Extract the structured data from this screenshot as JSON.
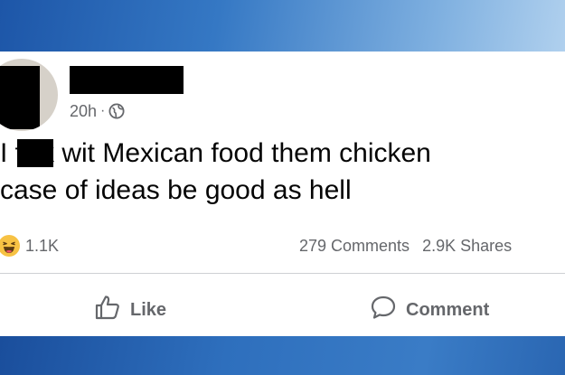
{
  "post": {
    "time": "20h",
    "separator": "·",
    "audience_icon": "globe-icon",
    "text_line1_start": "I f",
    "text_line1_end": "k wit Mexican food them chicken",
    "text_line2": "case of ideas be good as hell"
  },
  "stats": {
    "reaction_icon": "haha-icon",
    "reaction_count": "1.1K",
    "comments": "279 Comments",
    "shares": "2.9K Shares"
  },
  "actions": {
    "like_label": "Like",
    "comment_label": "Comment"
  },
  "colors": {
    "secondary_text": "#65676b",
    "post_text": "#050505",
    "haha_yellow": "#f7c244",
    "background_blue": "#2e6fbd"
  }
}
